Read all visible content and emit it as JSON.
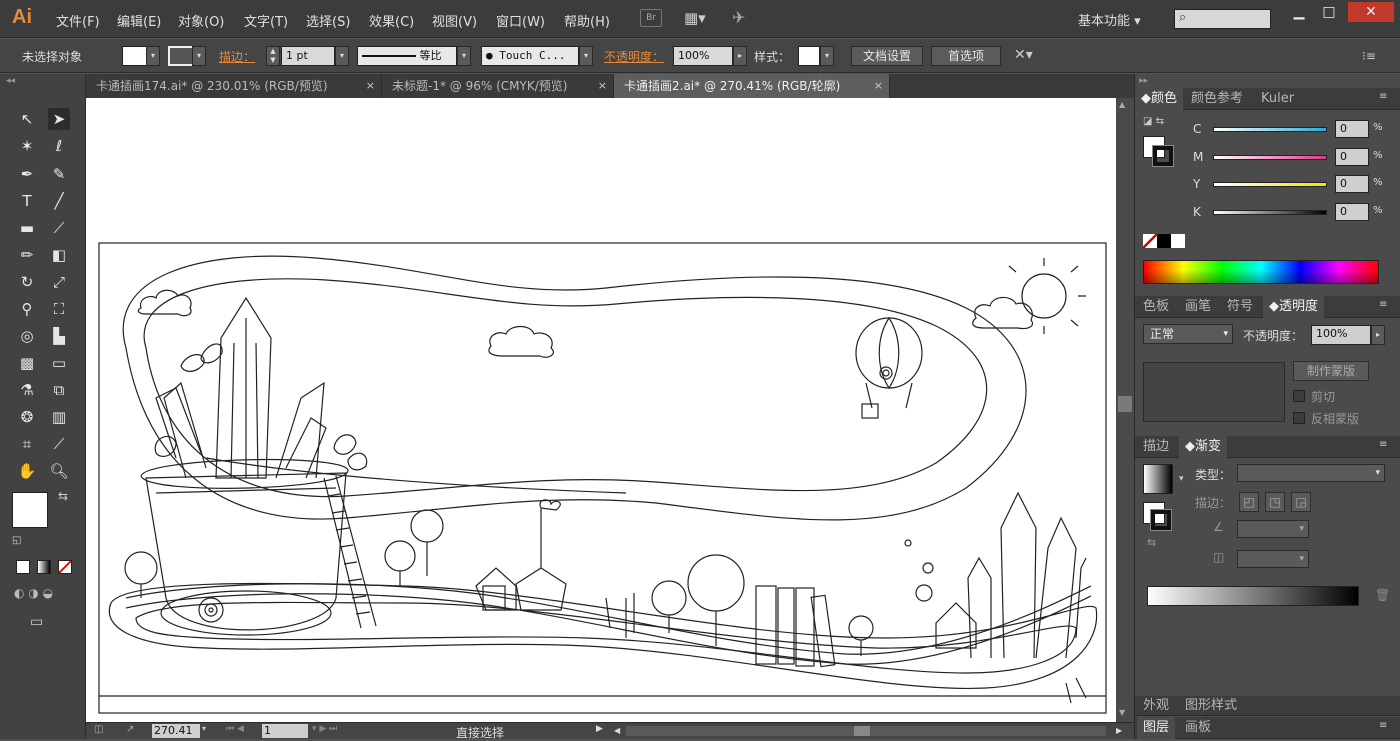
{
  "app": {
    "logo": "Ai"
  },
  "menu": [
    "文件(F)",
    "编辑(E)",
    "对象(O)",
    "文字(T)",
    "选择(S)",
    "效果(C)",
    "视图(V)",
    "窗口(W)",
    "帮助(H)"
  ],
  "menu_icons": {
    "bridge": "Br"
  },
  "workspace": "基本功能",
  "control_bar": {
    "selection_status": "未选择对象",
    "stroke_label": "描边：",
    "stroke_weight": "1 pt",
    "stroke_profile": "等比",
    "brush": "Touch C...",
    "opacity_label": "不透明度：",
    "opacity_value": "100%",
    "style_label": "样式：",
    "doc_setup": "文档设置",
    "preferences": "首选项"
  },
  "tabs": [
    {
      "label": "卡通插画174.ai* @ 230.01% (RGB/预览)",
      "close": "×"
    },
    {
      "label": "未标题-1* @ 96% (CMYK/预览)",
      "close": "×"
    },
    {
      "label": "卡通插画2.ai* @ 270.41% (RGB/轮廓)",
      "close": "×"
    }
  ],
  "color_panel": {
    "tabs": [
      "颜色",
      "颜色参考",
      "Kuler"
    ],
    "channels": [
      {
        "name": "C",
        "value": "0",
        "unit": "%",
        "color": "#29a9d8"
      },
      {
        "name": "M",
        "value": "0",
        "unit": "%",
        "color": "#e0368d"
      },
      {
        "name": "Y",
        "value": "0",
        "unit": "%",
        "color": "#f2e400"
      },
      {
        "name": "K",
        "value": "0",
        "unit": "%",
        "color": "#000000"
      }
    ]
  },
  "transparency_panel": {
    "tabs": [
      "色板",
      "画笔",
      "符号",
      "透明度"
    ],
    "mode": "正常",
    "opacity_label": "不透明度：",
    "opacity_value": "100%",
    "make_mask": "制作蒙版",
    "clip": "剪切",
    "invert_mask": "反相蒙版"
  },
  "gradient_panel": {
    "tabs": [
      "描边",
      "渐变"
    ],
    "type_label": "类型：",
    "stroke_label": "描边："
  },
  "bottom_panels": {
    "tabs": [
      "外观",
      "图形样式"
    ],
    "tabs2": [
      "图层",
      "画板"
    ]
  },
  "status_bar": {
    "zoom": "270.41",
    "artboard": "1",
    "tool": "直接选择"
  }
}
